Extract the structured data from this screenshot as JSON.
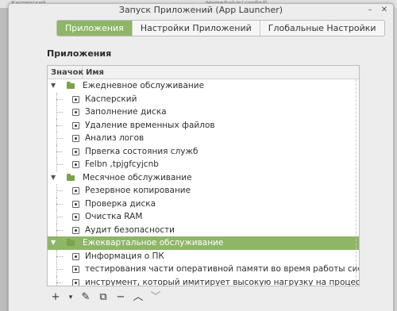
{
  "background": {
    "title_fragments": [
      "Касперский",
      "/Home/balvis/.config/ll"
    ]
  },
  "window": {
    "title": "Запуск Приложений (App Launcher)",
    "minimize": "–",
    "close": "✕"
  },
  "tabs": [
    {
      "label": "Приложения",
      "active": true
    },
    {
      "label": "Настройки Приложений",
      "active": false
    },
    {
      "label": "Глобальные Настройки",
      "active": false
    }
  ],
  "section": {
    "title": "Приложения"
  },
  "tree": {
    "columns": {
      "icon": "Значок",
      "name": "Имя"
    },
    "rows": [
      {
        "type": "category",
        "label": "Ежедневное обслуживание",
        "expanded": true,
        "selected": false
      },
      {
        "type": "app",
        "label": "Касперский"
      },
      {
        "type": "app",
        "label": "Заполнение диска"
      },
      {
        "type": "app",
        "label": "Удаление временных файлов"
      },
      {
        "type": "app",
        "label": "Анализ логов"
      },
      {
        "type": "app",
        "label": "Првеrка состояния служб"
      },
      {
        "type": "app",
        "label": "Felbn ,tpjgfcyjcnb"
      },
      {
        "type": "category",
        "label": "Месячное обслуживание",
        "expanded": true,
        "selected": false
      },
      {
        "type": "app",
        "label": "Резервное копирование"
      },
      {
        "type": "app",
        "label": "Проверка диска"
      },
      {
        "type": "app",
        "label": "Очистка RAM"
      },
      {
        "type": "app",
        "label": "Аудит безопасности"
      },
      {
        "type": "category",
        "label": "Ежеквартальное обслуживание",
        "expanded": true,
        "selected": true
      },
      {
        "type": "app",
        "label": "Информация о ПК"
      },
      {
        "type": "app",
        "label": "тестирования части оперативной памяти во время работы системы"
      },
      {
        "type": "app",
        "label": "инструмент, который имитирует высокую нагрузку на процессор."
      }
    ]
  },
  "toolbar": {
    "add": "+",
    "add_menu": "▾",
    "edit": "✎",
    "duplicate": "⧉",
    "remove": "−",
    "move_up": "︿",
    "move_down": "﹀"
  },
  "colors": {
    "accent": "#8fb567",
    "folder": "#7aa34a"
  }
}
